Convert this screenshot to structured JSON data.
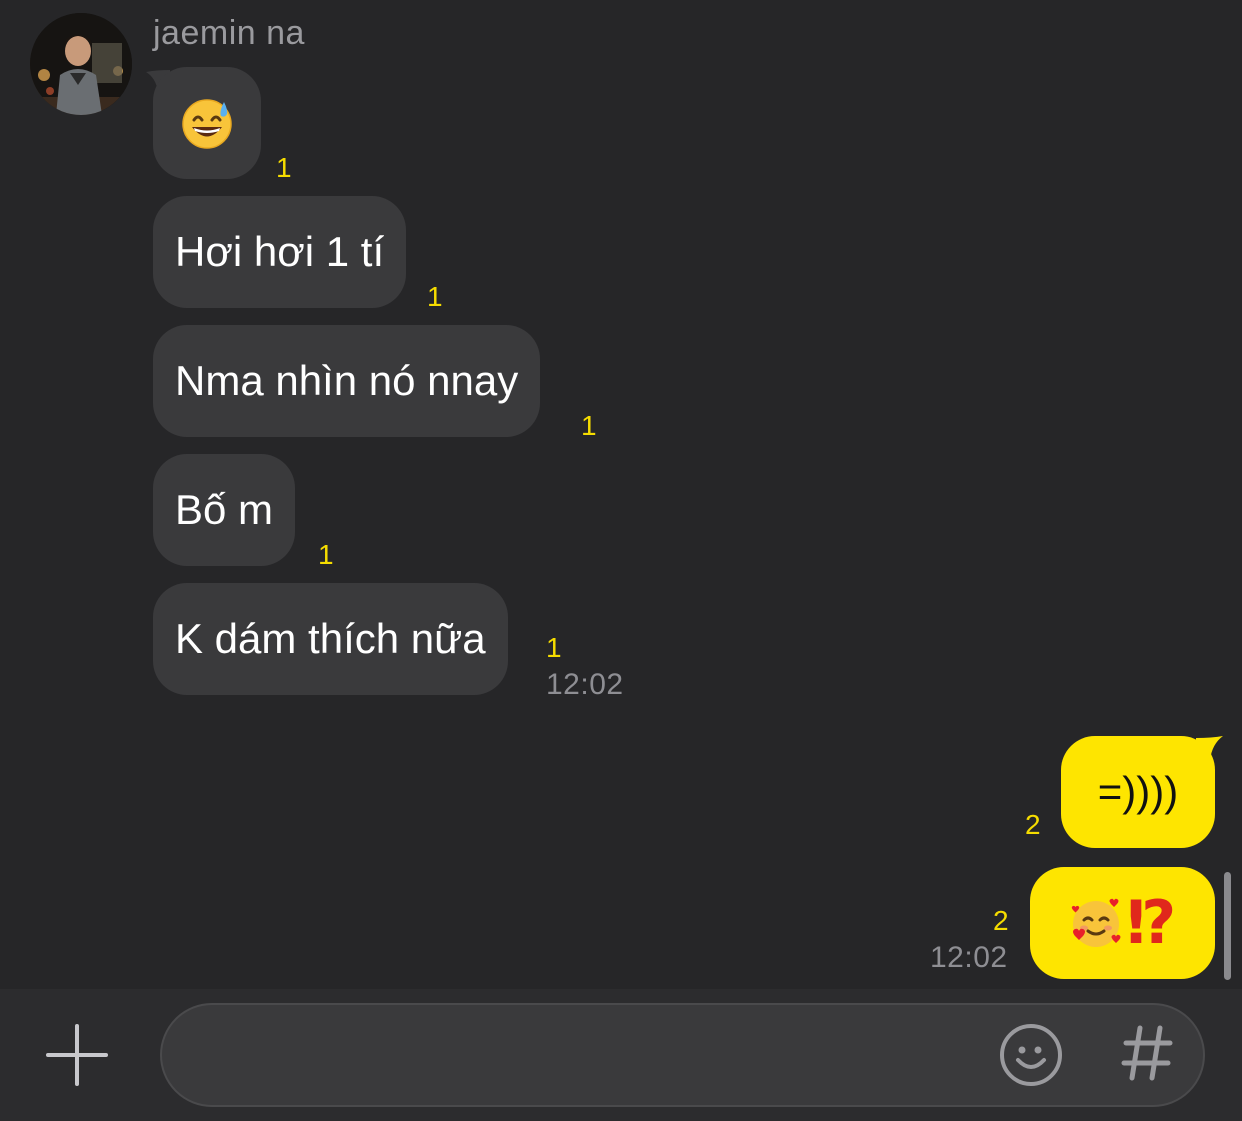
{
  "chat": {
    "sender_name": "jaemin na",
    "incoming": [
      {
        "type": "emoji",
        "emoji": "grinning-face-with-sweat",
        "unread": "1"
      },
      {
        "type": "text",
        "text": "Hơi hơi 1 tí",
        "unread": "1"
      },
      {
        "type": "text",
        "text": "Nma nhìn nó nnay",
        "unread": "1"
      },
      {
        "type": "text",
        "text": "Bố m",
        "unread": "1"
      },
      {
        "type": "text",
        "text": "K dám thích nữa",
        "unread": "1"
      }
    ],
    "incoming_time": "12:02",
    "outgoing": [
      {
        "type": "text",
        "text": "=))))",
        "unread": "2"
      },
      {
        "type": "emoji",
        "emoji": "smiling-face-with-hearts",
        "text": "⁉",
        "unread": "2"
      }
    ],
    "outgoing_time": "12:02"
  },
  "colors": {
    "background": "#262628",
    "incoming_bubble": "#3a3a3c",
    "outgoing_bubble": "#fee500",
    "unread_count": "#f5dc00",
    "timestamp": "#8e8e93"
  },
  "input_bar": {
    "add_icon": "plus-icon",
    "emoji_icon": "emoji-icon",
    "hashtag_icon": "hashtag-icon"
  }
}
